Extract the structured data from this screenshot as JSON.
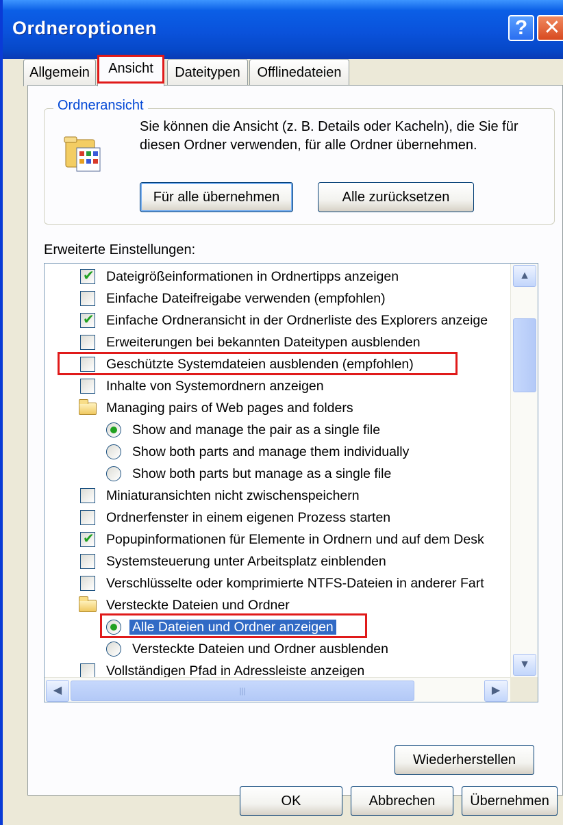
{
  "window": {
    "title": "Ordneroptionen"
  },
  "tabs": [
    "Allgemein",
    "Ansicht",
    "Dateitypen",
    "Offlinedateien"
  ],
  "folder_view": {
    "title": "Ordneransicht",
    "text": "Sie können die Ansicht (z. B. Details oder Kacheln), die Sie für diesen Ordner verwenden, für alle Ordner übernehmen.",
    "apply_all_label": "Für alle übernehmen",
    "reset_all_label": "Alle zurücksetzen"
  },
  "advanced": {
    "label": "Erweiterte Einstellungen:",
    "items": [
      {
        "type": "checkbox",
        "checked": true,
        "text": "Dateigrößeinformationen in Ordnertipps anzeigen"
      },
      {
        "type": "checkbox",
        "checked": false,
        "text": "Einfache Dateifreigabe verwenden (empfohlen)"
      },
      {
        "type": "checkbox",
        "checked": true,
        "text": "Einfache Ordneransicht in der Ordnerliste des Explorers anzeige"
      },
      {
        "type": "checkbox",
        "checked": false,
        "text": "Erweiterungen bei bekannten Dateitypen ausblenden"
      },
      {
        "type": "checkbox",
        "checked": false,
        "text": "Geschützte Systemdateien ausblenden (empfohlen)"
      },
      {
        "type": "checkbox",
        "checked": false,
        "text": "Inhalte von Systemordnern anzeigen"
      },
      {
        "type": "folder",
        "text": "Managing pairs of Web pages and folders"
      },
      {
        "type": "radio",
        "checked": true,
        "text": "Show and manage the pair as a single file"
      },
      {
        "type": "radio",
        "checked": false,
        "text": "Show both parts and manage them individually"
      },
      {
        "type": "radio",
        "checked": false,
        "text": "Show both parts but manage as a single file"
      },
      {
        "type": "checkbox",
        "checked": false,
        "text": "Miniaturansichten nicht zwischenspeichern"
      },
      {
        "type": "checkbox",
        "checked": false,
        "text": "Ordnerfenster in einem eigenen Prozess starten"
      },
      {
        "type": "checkbox",
        "checked": true,
        "text": "Popupinformationen für Elemente in Ordnern und auf dem Desk"
      },
      {
        "type": "checkbox",
        "checked": false,
        "text": "Systemsteuerung unter Arbeitsplatz einblenden"
      },
      {
        "type": "checkbox",
        "checked": false,
        "text": "Verschlüsselte oder komprimierte NTFS-Dateien in anderer Fart"
      },
      {
        "type": "folder",
        "text": "Versteckte Dateien und Ordner"
      },
      {
        "type": "radio",
        "checked": true,
        "selected": true,
        "text": "Alle Dateien und Ordner anzeigen"
      },
      {
        "type": "radio",
        "checked": false,
        "text": "Versteckte Dateien und Ordner ausblenden"
      },
      {
        "type": "checkbox",
        "checked": false,
        "text": "Vollständigen Pfad in Adressleiste anzeigen"
      }
    ]
  },
  "buttons": {
    "restore_label": "Wiederherstellen",
    "ok_label": "OK",
    "cancel_label": "Abbrechen",
    "apply_label": "Übernehmen"
  },
  "colors": {
    "titlebar": "#0a52db",
    "dialog_bg": "#ece9d8",
    "selection": "#316ac5",
    "highlight_box": "#e01a1a",
    "check_green": "#21a121"
  }
}
